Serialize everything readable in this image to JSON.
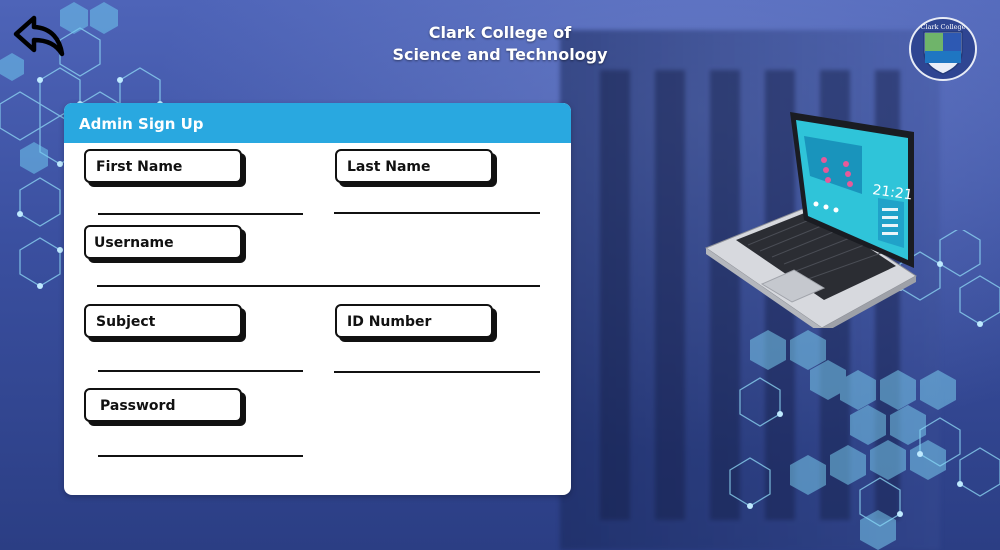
{
  "header": {
    "college_line1": "Clark College of",
    "college_line2": "Science and Technology",
    "logo_text": "Clark College"
  },
  "form": {
    "title": "Admin Sign Up",
    "fields": {
      "first_name": {
        "label": "First Name",
        "value": ""
      },
      "last_name": {
        "label": "Last Name",
        "value": ""
      },
      "username": {
        "label": "Username",
        "value": ""
      },
      "subject": {
        "label": "Subject",
        "value": ""
      },
      "id_number": {
        "label": "ID Number",
        "value": ""
      },
      "password": {
        "label": "Password",
        "value": ""
      }
    }
  },
  "laptop_screen_text": "21:21",
  "icons": {
    "back": "back-arrow-icon",
    "logo": "college-logo-icon",
    "illustration": "laptop-illustration"
  },
  "colors": {
    "accent": "#29a8e0",
    "panel": "#ffffff",
    "background": "#3a4f9f",
    "hex_pattern": "#7fd6f5"
  }
}
